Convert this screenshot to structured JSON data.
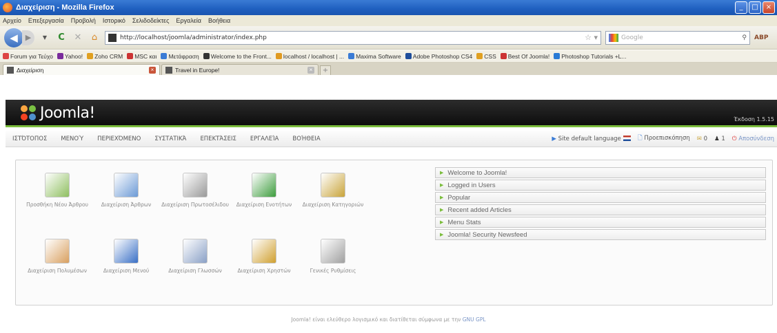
{
  "window": {
    "title": "Διαχείριση - Mozilla Firefox",
    "controls": [
      "_",
      "□",
      "×"
    ]
  },
  "menubar": [
    "Αρχείο",
    "Επεξεργασία",
    "Προβολή",
    "Ιστορικό",
    "Σελιδοδείκτες",
    "Εργαλεία",
    "Βοήθεια"
  ],
  "navbar": {
    "url": "http://localhost/joomla/administrator/index.php",
    "search_placeholder": "Google"
  },
  "bookmarks": [
    {
      "label": "Forum για Τεύχο",
      "color": "#d44"
    },
    {
      "label": "Yahoo!",
      "color": "#7a2c9c"
    },
    {
      "label": "Zoho CRM",
      "color": "#e0a020"
    },
    {
      "label": "MSC και",
      "color": "#c33"
    },
    {
      "label": "Μετάφραση",
      "color": "#3a7bd5"
    },
    {
      "label": "Welcome to the Front...",
      "color": "#333"
    },
    {
      "label": "localhost / localhost | ...",
      "color": "#e09a20"
    },
    {
      "label": "Maxima Software",
      "color": "#3a7bd5"
    },
    {
      "label": "Adobe Photoshop CS4",
      "color": "#1f4e9b"
    },
    {
      "label": "CSS",
      "color": "#e0a020"
    },
    {
      "label": "Best Of Joomla!",
      "color": "#c33"
    },
    {
      "label": "Photoshop Tutorials +L...",
      "color": "#2a7bd5"
    }
  ],
  "tabs": [
    {
      "label": "Διαχείριση",
      "active": true
    },
    {
      "label": "Travel in Europe!",
      "active": false
    }
  ],
  "joomla": {
    "logo_text": "Joomla!",
    "version": "Έκδοση 1.5.15",
    "menu": [
      "Ιστότοπος",
      "Μενού",
      "Περιεχόμενο",
      "Συστατικά",
      "Επεκτάσεις",
      "Εργαλεία",
      "Βοήθεια"
    ],
    "status": {
      "preview": "Site default language",
      "messages": "Προεπισκόπηση",
      "count1": "0",
      "count2": "1",
      "logout": "Αποσύνδεση"
    }
  },
  "quick_icons": [
    {
      "label": "Προσθήκη Νέου Άρθρου",
      "icon": "add-article-icon",
      "color": "#8fbf60"
    },
    {
      "label": "Διαχείριση Άρθρων",
      "icon": "article-manager-icon",
      "color": "#6c9ad6"
    },
    {
      "label": "Διαχείριση Πρωτοσέλιδου",
      "icon": "frontpage-manager-icon",
      "color": "#9a9a9a"
    },
    {
      "label": "Διαχείριση Ενοτήτων",
      "icon": "section-manager-icon",
      "color": "#3e9d3e"
    },
    {
      "label": "Διαχείριση Κατηγοριών",
      "icon": "category-manager-icon",
      "color": "#c9a43a"
    },
    {
      "label": "Διαχείριση Πολυμέσων",
      "icon": "media-manager-icon",
      "color": "#d9a060"
    },
    {
      "label": "Διαχείριση Μενού",
      "icon": "menu-manager-icon",
      "color": "#3a70c6"
    },
    {
      "label": "Διαχείριση Γλωσσών",
      "icon": "language-manager-icon",
      "color": "#8aa0c6"
    },
    {
      "label": "Διαχείριση Χρηστών",
      "icon": "user-manager-icon",
      "color": "#d0a030"
    },
    {
      "label": "Γενικές Ρυθμίσεις",
      "icon": "global-config-icon",
      "color": "#a0a0a0"
    }
  ],
  "modules": [
    "Welcome to Joomla!",
    "Logged in Users",
    "Popular",
    "Recent added Articles",
    "Menu Stats",
    "Joomla! Security Newsfeed"
  ],
  "footer": {
    "text": "Joomla! είναι ελεύθερο λογισμικό και διατίθεται σύμφωνα με την",
    "link": "GNU GPL"
  }
}
